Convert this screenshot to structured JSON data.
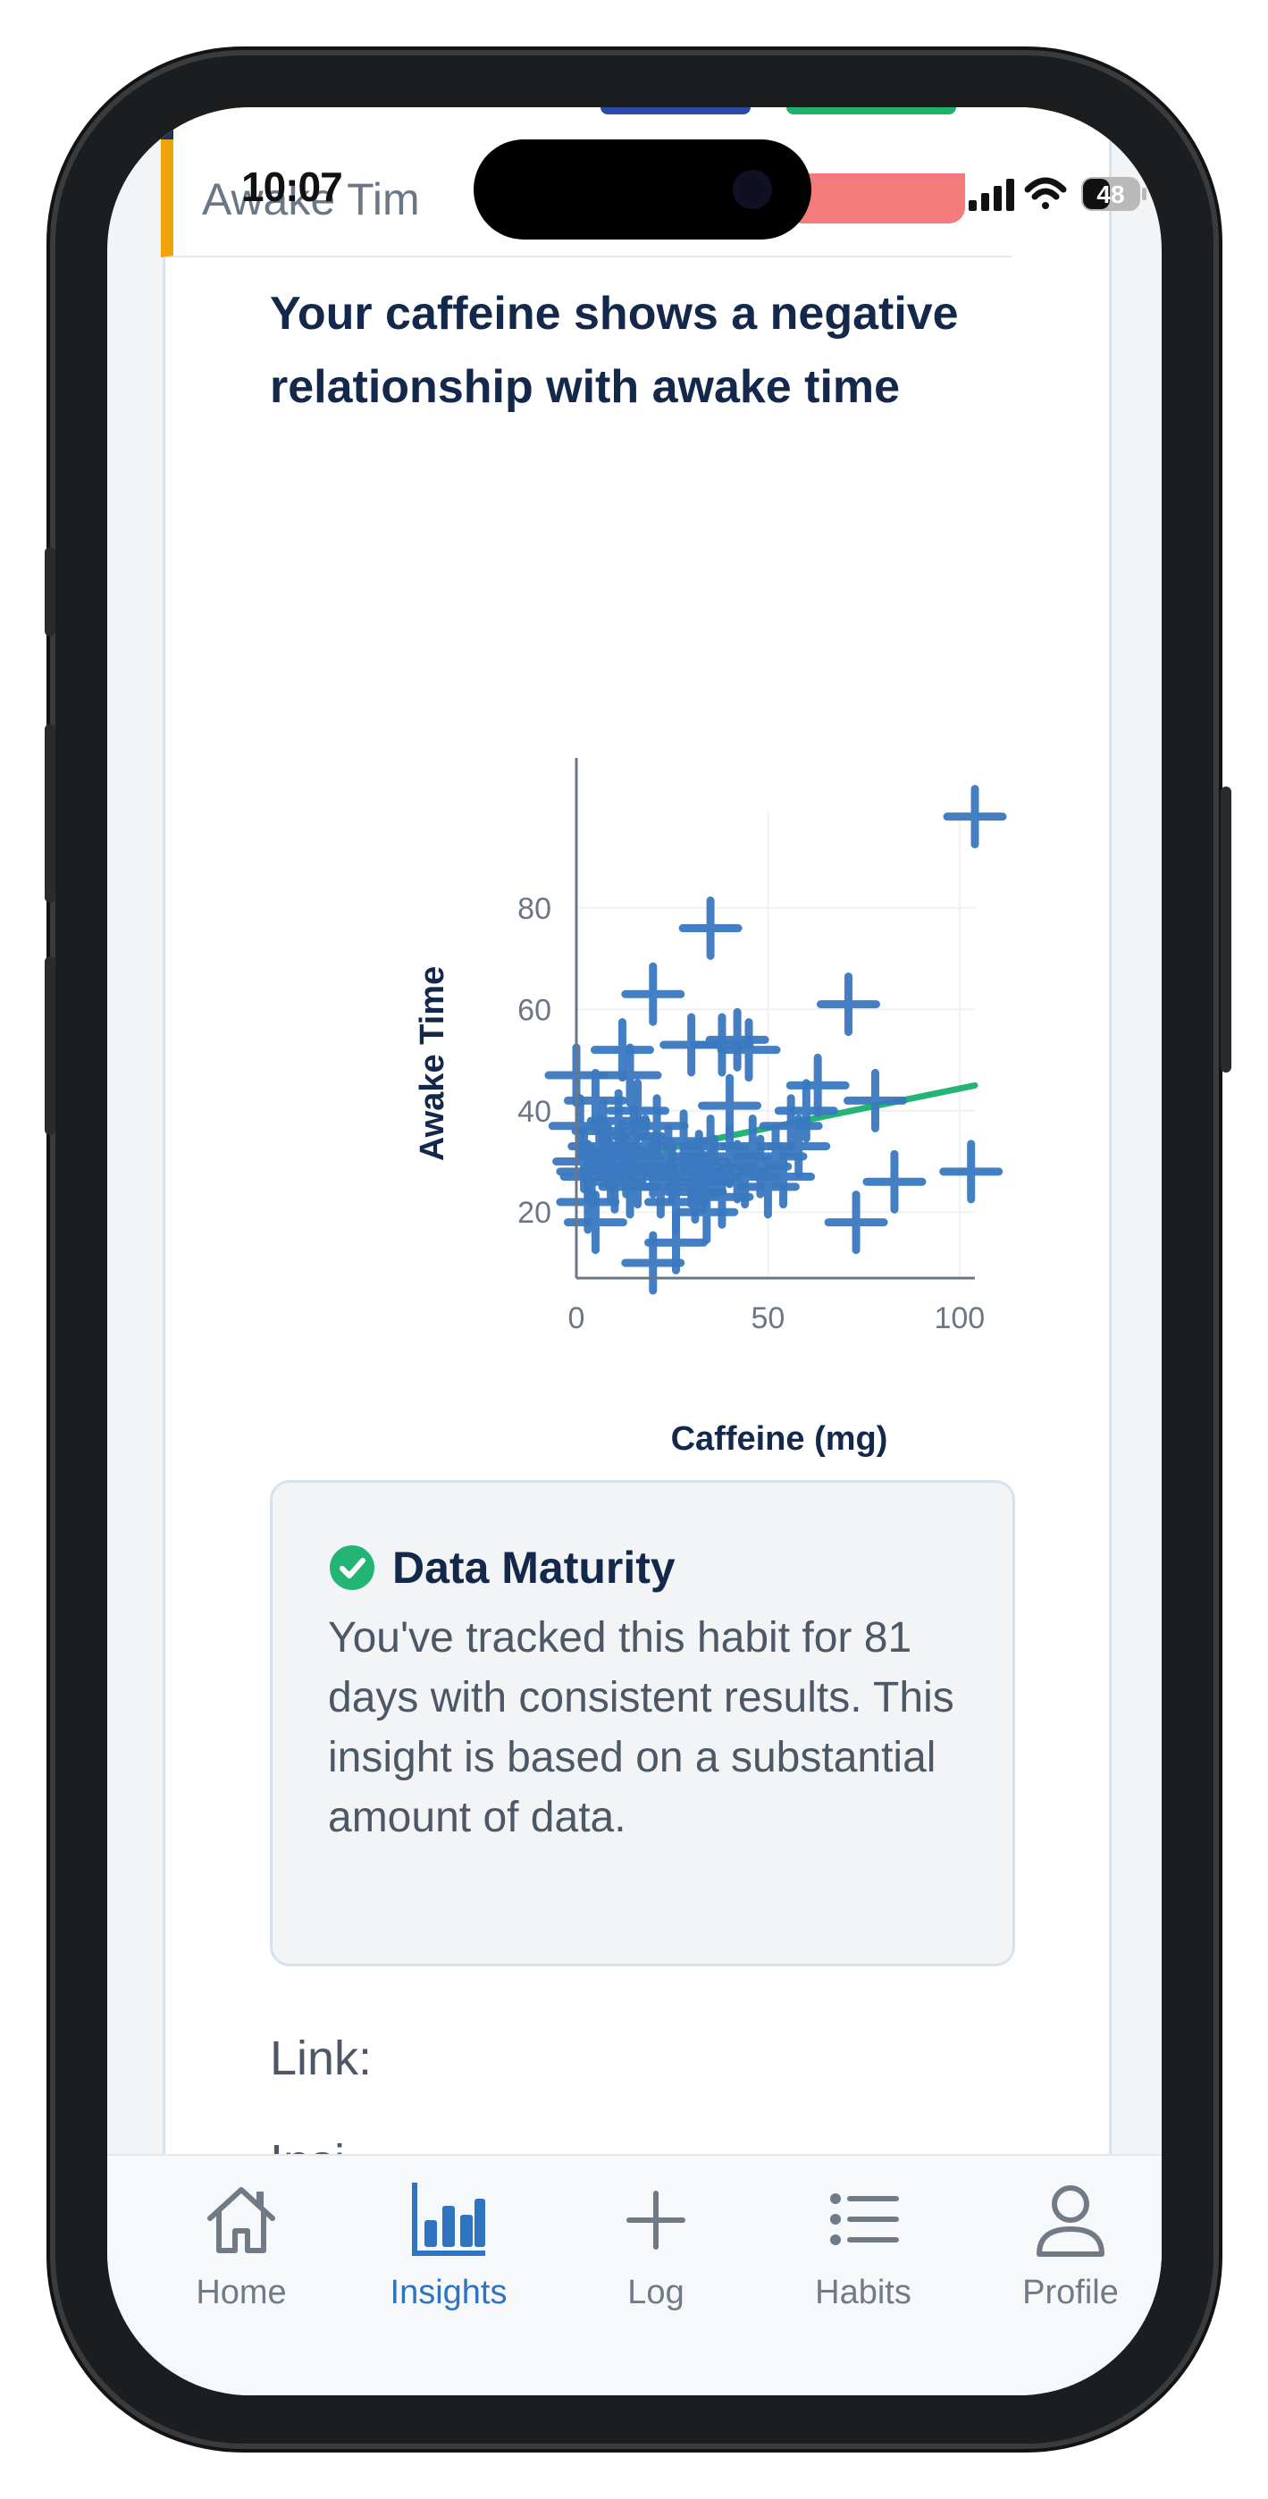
{
  "status_bar": {
    "time": "10:07",
    "battery": "48"
  },
  "previous_item": {
    "title": "Awake Tim"
  },
  "insight": {
    "headline": "Your caffeine shows a negative relationship with awake time"
  },
  "chart_data": {
    "type": "scatter",
    "xlabel": "Caffeine (mg)",
    "ylabel": "Awake Time",
    "xlim": [
      0,
      104
    ],
    "ylim": [
      7,
      99
    ],
    "x_ticks": [
      "0",
      "50",
      "100"
    ],
    "y_ticks": [
      "20",
      "40",
      "60",
      "80"
    ],
    "grid": true,
    "marker": "cross",
    "colors": {
      "points": "#3a78c0",
      "trend": "#22b573",
      "axis": "#6b7785"
    },
    "points": [
      [
        0,
        47
      ],
      [
        1,
        37
      ],
      [
        2,
        30
      ],
      [
        3,
        28
      ],
      [
        4,
        27
      ],
      [
        5,
        42
      ],
      [
        6,
        33
      ],
      [
        7,
        36
      ],
      [
        8,
        31
      ],
      [
        9,
        28
      ],
      [
        10,
        26
      ],
      [
        11,
        38
      ],
      [
        12,
        32
      ],
      [
        13,
        29
      ],
      [
        14,
        25
      ],
      [
        15,
        35
      ],
      [
        16,
        27
      ],
      [
        3,
        22
      ],
      [
        5,
        18
      ],
      [
        12,
        52
      ],
      [
        14,
        47
      ],
      [
        16,
        40
      ],
      [
        18,
        33
      ],
      [
        20,
        29
      ],
      [
        21,
        37
      ],
      [
        22,
        25
      ],
      [
        24,
        31
      ],
      [
        25,
        28
      ],
      [
        26,
        22
      ],
      [
        28,
        34
      ],
      [
        30,
        27
      ],
      [
        31,
        24
      ],
      [
        32,
        30
      ],
      [
        33,
        26
      ],
      [
        34,
        20
      ],
      [
        35,
        33
      ],
      [
        36,
        29
      ],
      [
        38,
        23
      ],
      [
        40,
        31
      ],
      [
        42,
        28
      ],
      [
        44,
        27
      ],
      [
        46,
        33
      ],
      [
        48,
        29
      ],
      [
        50,
        25
      ],
      [
        52,
        31
      ],
      [
        54,
        27
      ],
      [
        56,
        37
      ],
      [
        58,
        33
      ],
      [
        60,
        40
      ],
      [
        63,
        45
      ],
      [
        20,
        63
      ],
      [
        30,
        53
      ],
      [
        35,
        76
      ],
      [
        38,
        53
      ],
      [
        40,
        41
      ],
      [
        42,
        54
      ],
      [
        45,
        52
      ],
      [
        26,
        14
      ],
      [
        20,
        10
      ],
      [
        71,
        61
      ],
      [
        78,
        42
      ],
      [
        83,
        26
      ],
      [
        73,
        18
      ],
      [
        103,
        28
      ],
      [
        104,
        98
      ]
    ],
    "trend_line": {
      "x": [
        14,
        104
      ],
      "y": [
        31,
        45
      ]
    }
  },
  "data_maturity": {
    "title": "Data Maturity",
    "body": "You've tracked this habit for 81 days with consistent results. This insight is based on a substantial amount of data."
  },
  "link_section": {
    "label": "Link:",
    "next_label": "Insi"
  },
  "tabbar": {
    "home": "Home",
    "insights": "Insights",
    "log": "Log",
    "habits": "Habits",
    "profile": "Profile"
  }
}
